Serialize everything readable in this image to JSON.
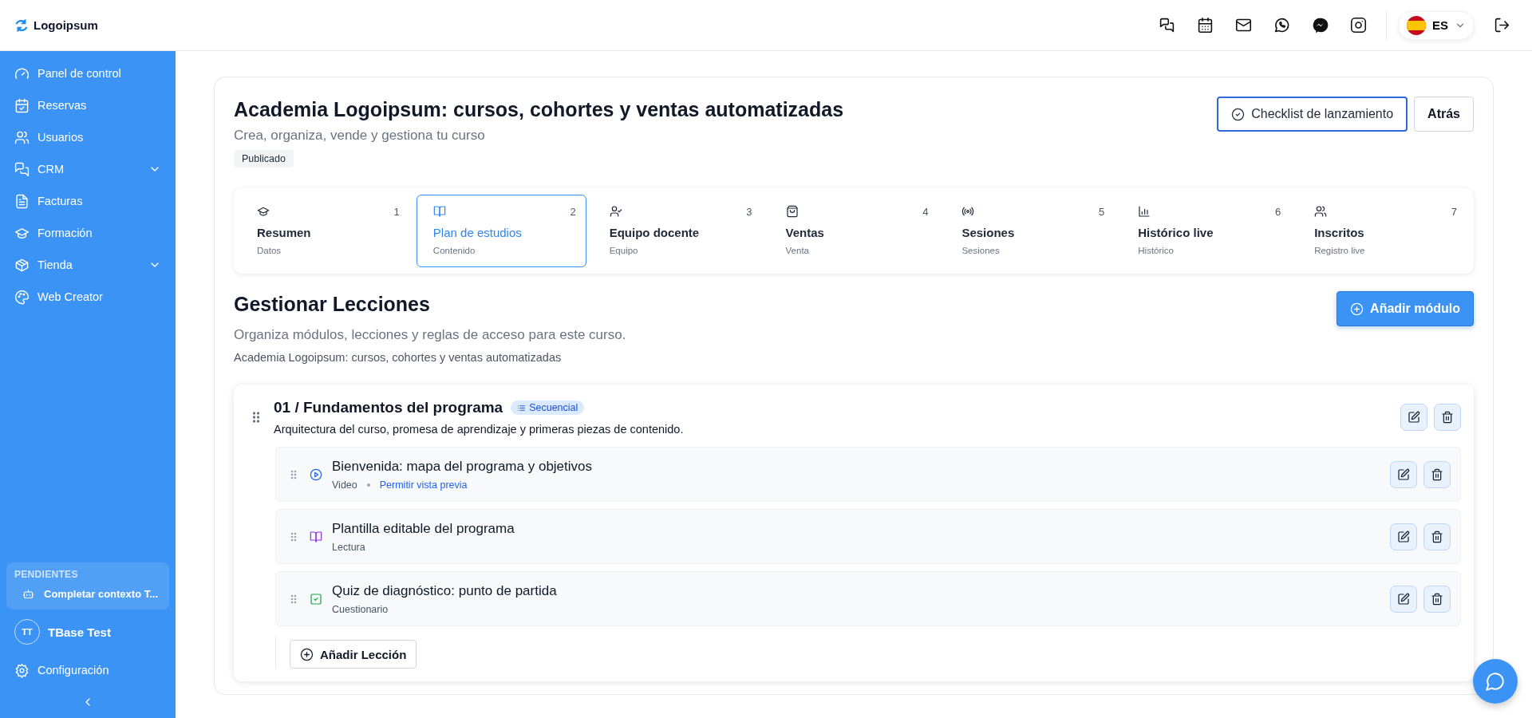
{
  "brand": {
    "name": "Logoipsum"
  },
  "topbar": {
    "language": "ES"
  },
  "sidebar": {
    "items": [
      {
        "label": "Panel de control",
        "expandable": false
      },
      {
        "label": "Reservas",
        "expandable": false
      },
      {
        "label": "Usuarios",
        "expandable": false
      },
      {
        "label": "CRM",
        "expandable": true
      },
      {
        "label": "Facturas",
        "expandable": false
      },
      {
        "label": "Formación",
        "expandable": false
      },
      {
        "label": "Tienda",
        "expandable": true
      },
      {
        "label": "Web Creator",
        "expandable": false
      }
    ],
    "pending": {
      "title": "PENDIENTES",
      "items": [
        "Completar contexto T..."
      ]
    },
    "user": {
      "initials": "TT",
      "name": "TBase Test"
    },
    "settings": "Configuración"
  },
  "course": {
    "title": "Academia Logoipsum: cursos, cohortes y ventas automatizadas",
    "subtitle": "Crea, organiza, vende y gestiona tu curso",
    "status": "Publicado"
  },
  "actions": [
    {
      "label": "Checklist de lanzamiento",
      "kind": "primary-outline"
    },
    {
      "label": "Atrás",
      "kind": "outline"
    }
  ],
  "steps": [
    {
      "number": "1",
      "title": "Resumen",
      "subtitle": "Datos",
      "selected": false
    },
    {
      "number": "2",
      "title": "Plan de estudios",
      "subtitle": "Contenido",
      "selected": true
    },
    {
      "number": "3",
      "title": "Equipo docente",
      "subtitle": "Equipo",
      "selected": false
    },
    {
      "number": "4",
      "title": "Ventas",
      "subtitle": "Venta",
      "selected": false
    },
    {
      "number": "5",
      "title": "Sesiones",
      "subtitle": "Sesiones",
      "selected": false
    },
    {
      "number": "6",
      "title": "Histórico live",
      "subtitle": "Histórico",
      "selected": false
    },
    {
      "number": "7",
      "title": "Inscritos",
      "subtitle": "Registro live",
      "selected": false
    }
  ],
  "section": {
    "title": "Gestionar Lecciones",
    "description": "Organiza módulos, lecciones y reglas de acceso para este curso.",
    "course_name": "Academia Logoipsum: cursos, cohortes y ventas automatizadas",
    "add_button": "Añadir módulo"
  },
  "modules": [
    {
      "title": "01 / Fundamentos del programa",
      "mode": "Secuencial",
      "description": "Arquitectura del curso, promesa de aprendizaje y primeras piezas de contenido.",
      "add_lesson": "Añadir Lección",
      "lessons": [
        {
          "kind": "video",
          "title": "Bienvenida: mapa del programa y objetivos",
          "type_label": "Video",
          "preview": "Permitir vista previa"
        },
        {
          "kind": "reading",
          "title": "Plantilla editable del programa",
          "type_label": "Lectura"
        },
        {
          "kind": "quiz",
          "title": "Quiz de diagnóstico: punto de partida",
          "type_label": "Cuestionario"
        }
      ]
    }
  ]
}
